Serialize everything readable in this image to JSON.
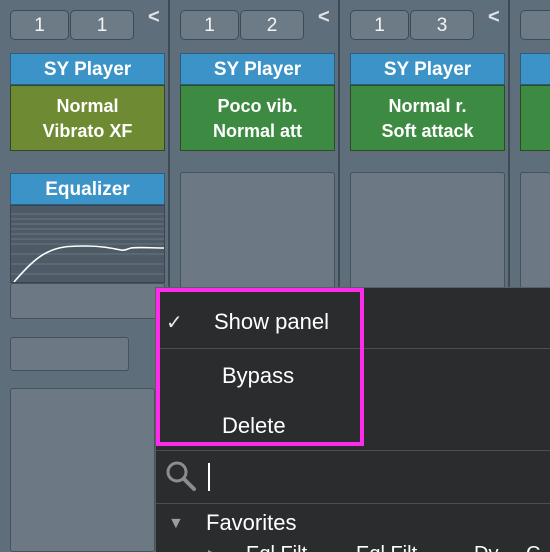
{
  "strips": [
    {
      "num_left": "1",
      "num_right": "1",
      "collapse": "<",
      "plugin": "SY Player",
      "preset_line1": "Normal",
      "preset_line2": "Vibrato XF"
    },
    {
      "num_left": "1",
      "num_right": "2",
      "collapse": "<",
      "plugin": "SY Player",
      "preset_line1": "Poco vib.",
      "preset_line2": "Normal att"
    },
    {
      "num_left": "1",
      "num_right": "3",
      "collapse": "<",
      "plugin": "SY Player",
      "preset_line1": "Normal r.",
      "preset_line2": "Soft attack"
    }
  ],
  "equalizer": {
    "title": "Equalizer"
  },
  "context_menu": {
    "check_mark": "✓",
    "show_panel": "Show panel",
    "bypass": "Bypass",
    "delete": "Delete",
    "search_value": "",
    "favorites_arrow": "▼",
    "favorites_label": "Favorites",
    "sub_arrow": "▶",
    "sub_items": [
      "Eql Filt",
      "Eql Filt",
      "Dy",
      "C"
    ]
  },
  "colors": {
    "plugin_header": "#3b93c7",
    "preset_olive": "#6e8a32",
    "preset_green": "#3d8a42",
    "highlight": "#ff2bea",
    "menu_bg": "#2b2c2e"
  }
}
